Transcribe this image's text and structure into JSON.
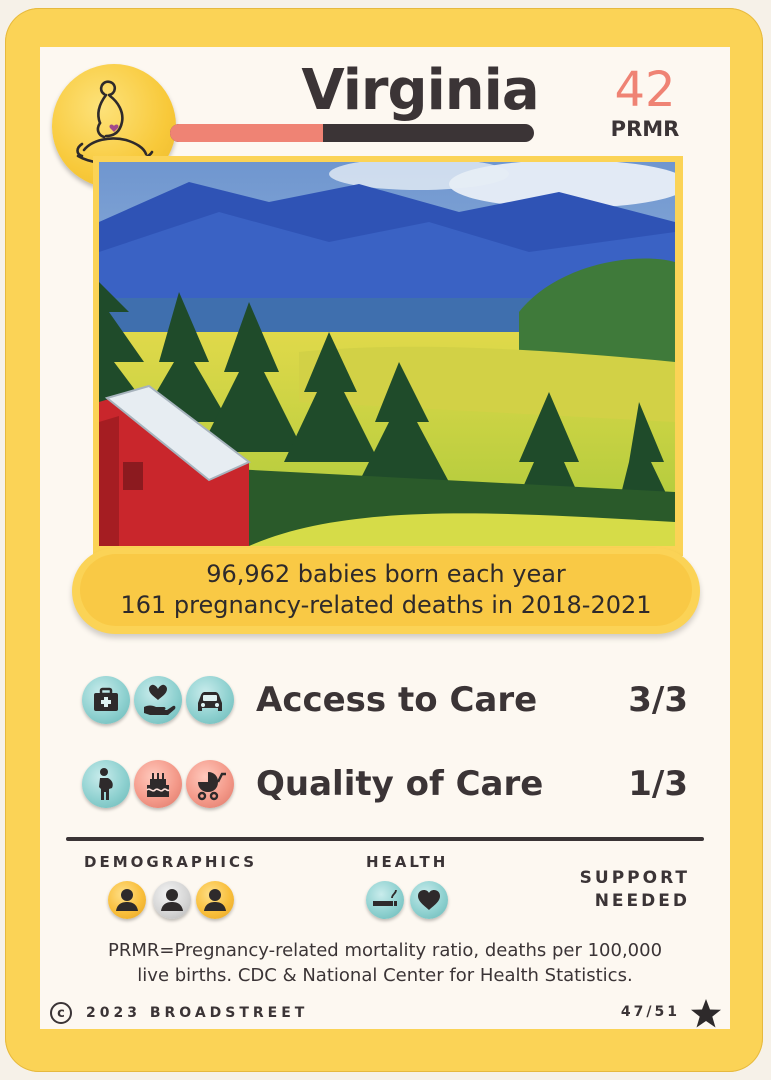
{
  "card": {
    "state": "Virginia",
    "prmr_value": "42",
    "prmr_label": "PRMR",
    "prmr_level": 0.42,
    "banner_line1": "96,962 babies born each year",
    "banner_line2": "161 pregnancy-related deaths in 2018-2021",
    "categories": [
      {
        "label": "Access to Care",
        "score": "3/3",
        "icons": [
          "first-aid-kit-icon",
          "caring-hand-heart-icon",
          "car-icon"
        ]
      },
      {
        "label": "Quality of Care",
        "score": "1/3",
        "icons": [
          "pregnant-person-icon",
          "birthday-cake-icon",
          "baby-stroller-icon"
        ]
      }
    ],
    "demographics_label": "DEMOGRAPHICS",
    "health_label": "HEALTH",
    "support_line1": "SUPPORT",
    "support_line2": "NEEDED",
    "footnote_line1": "PRMR=Pregnancy-related mortality ratio, deaths per 100,000",
    "footnote_line2": "live births. CDC & National Center for Health Statistics.",
    "copyright": "2023 BROADSTREET",
    "card_number": "47/51"
  },
  "colors": {
    "card_yellow": "#fbd356",
    "dark": "#3b3436",
    "salmon": "#ef8374",
    "teal": "#8fd1d0",
    "cream": "#fdf8f1"
  },
  "icons": {
    "logo": "pregnant-mother-logo",
    "demographics": [
      "person-icon",
      "person-icon",
      "person-icon"
    ],
    "health": [
      "cigarette-icon",
      "heart-icon"
    ],
    "copyright": "copyright-icon",
    "star": "star-icon"
  }
}
